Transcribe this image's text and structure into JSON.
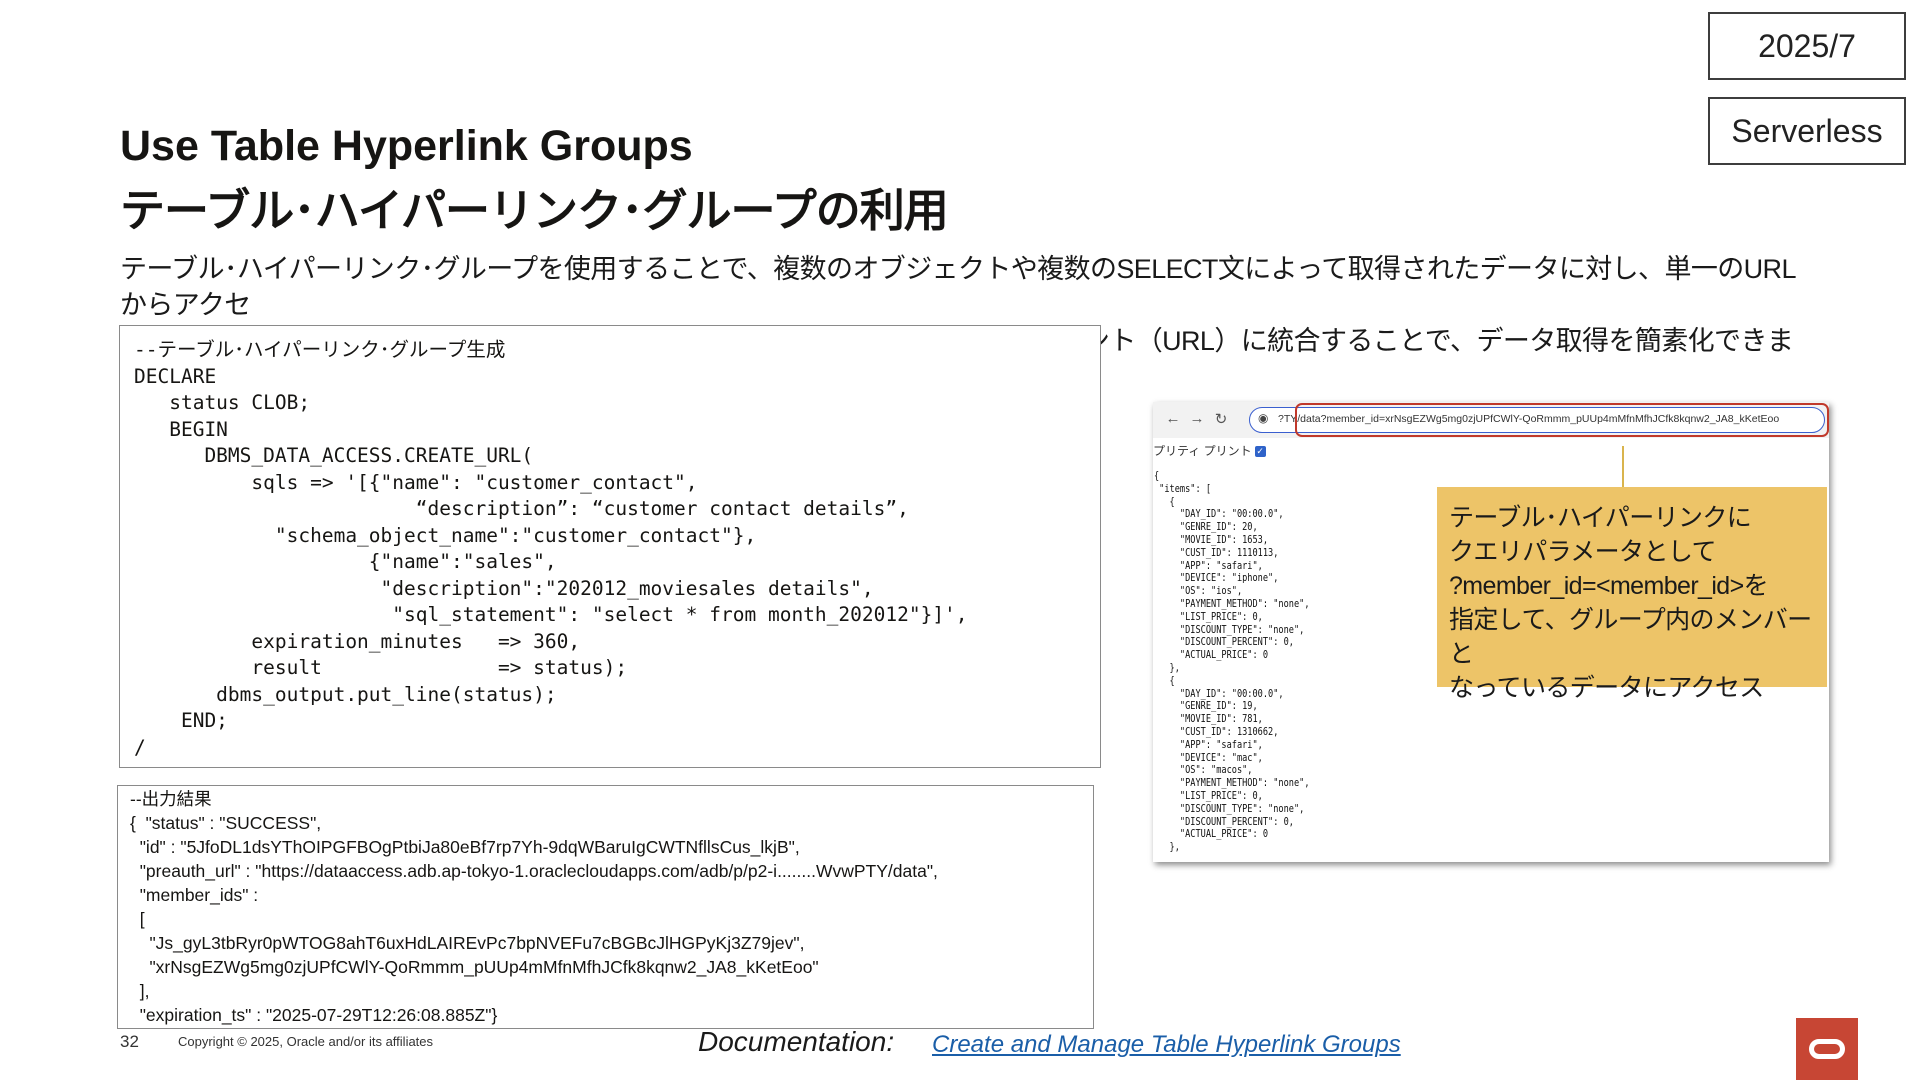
{
  "tags": {
    "date": "2025/7",
    "service": "Serverless"
  },
  "title": {
    "en": "Use Table Hyperlink Groups",
    "jp": "テーブル･ハイパーリンク･グループの利用"
  },
  "intro": {
    "line1": "テーブル･ハイパーリンク･グループを使用することで、複数のオブジェクトや複数のSELECT文によって取得されたデータに対し、単一のURLからアクセ",
    "line2": "スできるようになりました。様々なオブジェクトに渡る情報を1つのアクセスポイント（URL）に統合することで、データ取得を簡素化できます。"
  },
  "code": {
    "lines": [
      "--テーブル･ハイパーリンク･グループ生成",
      "DECLARE",
      "   status CLOB;",
      "   BEGIN",
      "      DBMS_DATA_ACCESS.CREATE_URL(",
      "          sqls => '[{\"name\": \"customer_contact\",",
      "                        “description”: “customer contact details”,",
      "            \"schema_object_name\":\"customer_contact\"},",
      "                    {\"name\":\"sales\",",
      "                     \"description\":\"202012_moviesales details\",",
      "                      \"sql_statement\": \"select * from month_202012\"}]',",
      "          expiration_minutes   => 360,",
      "          result               => status);",
      "       dbms_output.put_line(status);",
      "    END;",
      "/"
    ]
  },
  "output": {
    "lines": [
      "--出力結果",
      "{  \"status\" : \"SUCCESS\",",
      "  \"id\" : \"5JfoDL1dsYThOIPGFBOgPtbiJa80eBf7rp7Yh-9dqWBaruIgCWTNfllsCus_lkjB\",",
      "  \"preauth_url\" : \"https://dataaccess.adb.ap-tokyo-1.oraclecloudapps.com/adb/p/p2-i........WvwPTY/data\",",
      "  \"member_ids\" :",
      "  [",
      "    \"Js_gyL3tbRyr0pWTOG8ahT6uxHdLAIREvPc7bpNVEFu7cBGBcJlHGPyKj3Z79jev\",",
      "    \"xrNsgEZWg5mg0zjUPfCWlY-QoRmmm_pUUp4mMfnMfhJCfk8kqnw2_JA8_kKetEoo\"",
      "  ],",
      "  \"expiration_ts\" : \"2025-07-29T12:26:08.885Z\"}"
    ]
  },
  "browser": {
    "nav_back": "←",
    "nav_forward": "→",
    "nav_reload": "↻",
    "url": "?TY/data?member_id=xrNsgEZWg5mg0zjUPfCWlY-QoRmmm_pUUp4mMfnMfhJCfk8kqnw2_JA8_kKetEoo",
    "pretty_label": "プリティ プリント",
    "json_lines": [
      "{",
      " \"items\": [",
      "   {",
      "     \"DAY_ID\": \"00:00.0\",",
      "     \"GENRE_ID\": 20,",
      "     \"MOVIE_ID\": 1653,",
      "     \"CUST_ID\": 1110113,",
      "     \"APP\": \"safari\",",
      "     \"DEVICE\": \"iphone\",",
      "     \"OS\": \"ios\",",
      "     \"PAYMENT_METHOD\": \"none\",",
      "     \"LIST_PRICE\": 0,",
      "     \"DISCOUNT_TYPE\": \"none\",",
      "     \"DISCOUNT_PERCENT\": 0,",
      "     \"ACTUAL_PRICE\": 0",
      "   },",
      "   {",
      "     \"DAY_ID\": \"00:00.0\",",
      "     \"GENRE_ID\": 19,",
      "     \"MOVIE_ID\": 781,",
      "     \"CUST_ID\": 1310662,",
      "     \"APP\": \"safari\",",
      "     \"DEVICE\": \"mac\",",
      "     \"OS\": \"macos\",",
      "     \"PAYMENT_METHOD\": \"none\",",
      "     \"LIST_PRICE\": 0,",
      "     \"DISCOUNT_TYPE\": \"none\",",
      "     \"DISCOUNT_PERCENT\": 0,",
      "     \"ACTUAL_PRICE\": 0",
      "   },"
    ]
  },
  "callout": {
    "line1": "テーブル･ハイパーリンクに",
    "line2": "クエリパラメータとして",
    "line3": "?member_id=<member_id>を",
    "line4": "指定して、グループ内のメンバーと",
    "line5": "なっているデータにアクセス"
  },
  "footer": {
    "page_number": "32",
    "copyright": "Copyright © 2025, Oracle and/or its affiliates",
    "doc_label": "Documentation:",
    "doc_link": "Create and Manage Table Hyperlink Groups"
  },
  "colors": {
    "accent_red": "#c74634",
    "callout_bg": "#edc468",
    "link": "#1a5ea8",
    "url_highlight": "#c0392b"
  }
}
